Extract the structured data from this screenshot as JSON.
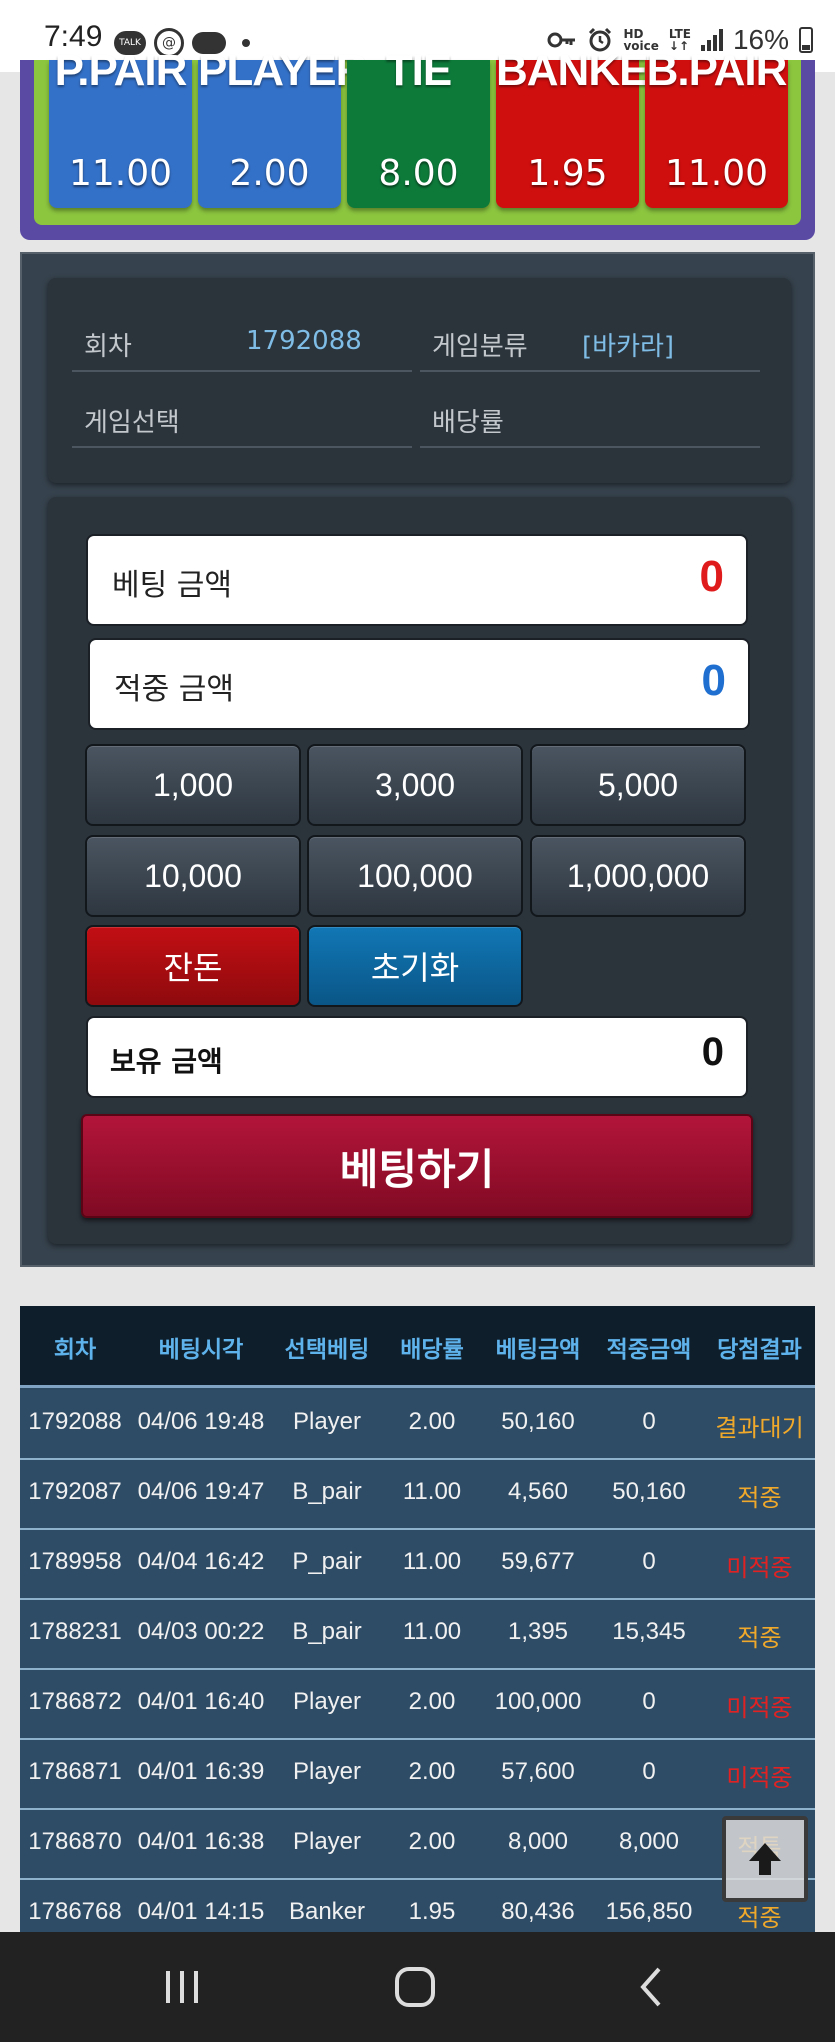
{
  "status_bar": {
    "time": "7:49",
    "talk_icon_text": "TALK",
    "battery": "16%"
  },
  "bet_board": {
    "tiles": [
      {
        "name": "P.PAIR",
        "odds": "11.00",
        "color": "#3370c7"
      },
      {
        "name": "PLAYER",
        "odds": "2.00",
        "color": "#3370c7"
      },
      {
        "name": "TIE",
        "odds": "8.00",
        "color": "#0d7a3a"
      },
      {
        "name": "BANKER",
        "odds": "1.95",
        "color": "#cf0e0e"
      },
      {
        "name": "B.PAIR",
        "odds": "11.00",
        "color": "#cf0e0e"
      }
    ]
  },
  "info": {
    "round_label": "회차",
    "round_value": "1792088",
    "category_label": "게임분류",
    "category_value": "[바카라]",
    "selection_label": "게임선택",
    "selection_value": "",
    "odds_label": "배당률",
    "odds_value": ""
  },
  "bet_form": {
    "bet_amount_label": "베팅 금액",
    "bet_amount_value": "0",
    "win_amount_label": "적중 금액",
    "win_amount_value": "0",
    "chips": [
      "1,000",
      "3,000",
      "5,000",
      "10,000",
      "100,000",
      "1,000,000"
    ],
    "remainder_label": "잔돈",
    "reset_label": "초기화",
    "owned_label": "보유 금액",
    "owned_value": "0",
    "submit_label": "베팅하기"
  },
  "history": {
    "headers": [
      "회차",
      "베팅시각",
      "선택베팅",
      "배당률",
      "베팅금액",
      "적중금액",
      "당첨결과"
    ],
    "rows": [
      {
        "round": "1792088",
        "time": "04/06 19:48",
        "pick": "Player",
        "odds": "2.00",
        "bet": "50,160",
        "win": "0",
        "result": "결과대기",
        "status": "wait"
      },
      {
        "round": "1792087",
        "time": "04/06 19:47",
        "pick": "B_pair",
        "odds": "11.00",
        "bet": "4,560",
        "win": "50,160",
        "result": "적중",
        "status": "hit"
      },
      {
        "round": "1789958",
        "time": "04/04 16:42",
        "pick": "P_pair",
        "odds": "11.00",
        "bet": "59,677",
        "win": "0",
        "result": "미적중",
        "status": "miss"
      },
      {
        "round": "1788231",
        "time": "04/03 00:22",
        "pick": "B_pair",
        "odds": "11.00",
        "bet": "1,395",
        "win": "15,345",
        "result": "적중",
        "status": "hit"
      },
      {
        "round": "1786872",
        "time": "04/01 16:40",
        "pick": "Player",
        "odds": "2.00",
        "bet": "100,000",
        "win": "0",
        "result": "미적중",
        "status": "miss"
      },
      {
        "round": "1786871",
        "time": "04/01 16:39",
        "pick": "Player",
        "odds": "2.00",
        "bet": "57,600",
        "win": "0",
        "result": "미적중",
        "status": "miss"
      },
      {
        "round": "1786870",
        "time": "04/01 16:38",
        "pick": "Player",
        "odds": "2.00",
        "bet": "8,000",
        "win": "8,000",
        "result": "적특",
        "status": "hit"
      },
      {
        "round": "1786768",
        "time": "04/01 14:15",
        "pick": "Banker",
        "odds": "1.95",
        "bet": "80,436",
        "win": "156,850",
        "result": "적중",
        "status": "hit"
      }
    ]
  },
  "colors": {
    "result_wait": "#f0a92a",
    "result_hit": "#f0a92a",
    "result_miss": "#e22222",
    "bet_amount_value": "#e01b1b",
    "win_amount_value": "#1f6fd0"
  },
  "icons": {
    "scroll_top": "arrow-up-icon",
    "nav_recents": "recents-icon",
    "nav_home": "home-icon",
    "nav_back": "back-icon"
  }
}
